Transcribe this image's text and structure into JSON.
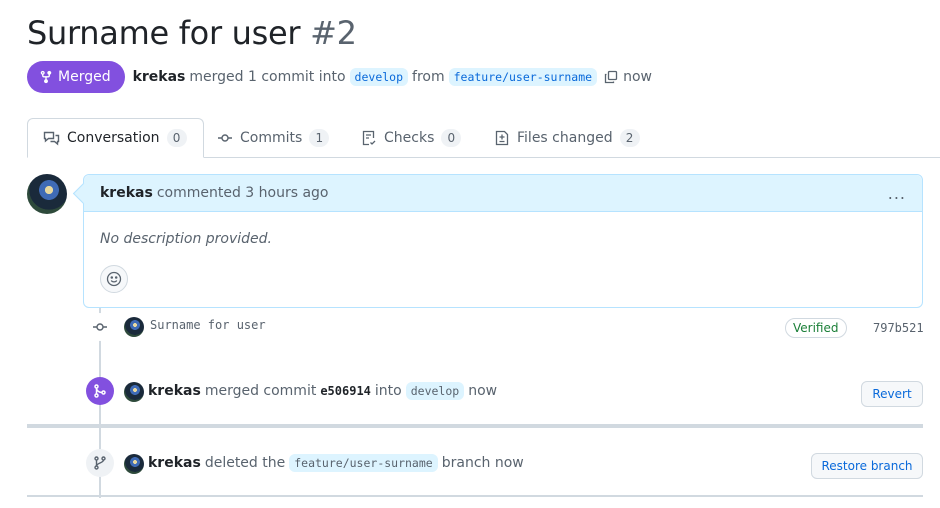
{
  "header": {
    "title": "Surname for user",
    "number": "#2",
    "state": "Merged",
    "author": "krekas",
    "merged_text": "merged 1 commit into",
    "base_branch": "develop",
    "from_text": "from",
    "head_branch": "feature/user-surname",
    "time": "now"
  },
  "tabs": [
    {
      "label": "Conversation",
      "count": "0",
      "icon": "comment-discussion-icon",
      "active": true
    },
    {
      "label": "Commits",
      "count": "1",
      "icon": "git-commit-icon"
    },
    {
      "label": "Checks",
      "count": "0",
      "icon": "checklist-icon"
    },
    {
      "label": "Files changed",
      "count": "2",
      "icon": "file-diff-icon"
    }
  ],
  "comment": {
    "author": "krekas",
    "action": "commented 3 hours ago",
    "body": "No description provided.",
    "menu": "..."
  },
  "commit": {
    "message": "Surname for user",
    "verified": "Verified",
    "sha": "797b521"
  },
  "merge_event": {
    "author": "krekas",
    "text1": "merged commit",
    "sha": "e506914",
    "text2": "into",
    "branch": "develop",
    "time": "now",
    "button": "Revert",
    "accent": "#8250df"
  },
  "delete_event": {
    "author": "krekas",
    "text1": "deleted the",
    "branch": "feature/user-surname",
    "text2": "branch now",
    "button": "Restore branch"
  }
}
